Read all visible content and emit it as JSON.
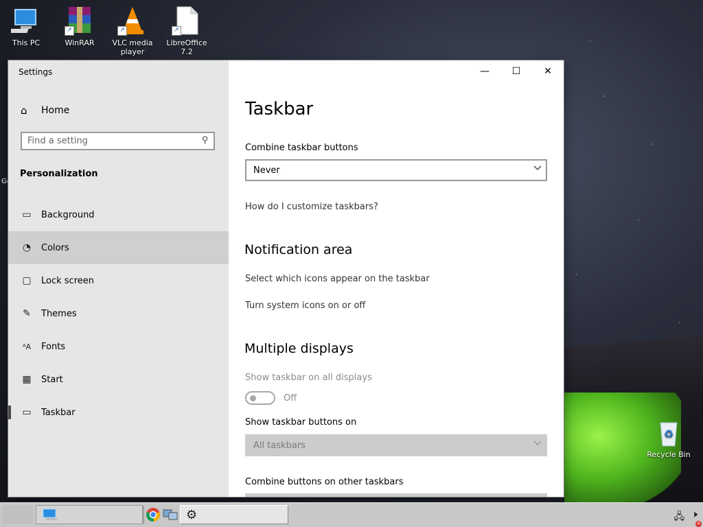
{
  "desktop": {
    "icons": [
      {
        "label": "This PC",
        "icon": "this-pc-icon"
      },
      {
        "label": "WinRAR",
        "icon": "winrar-icon"
      },
      {
        "label": "VLC media player",
        "icon": "vlc-icon"
      },
      {
        "label": "LibreOffice 7.2",
        "icon": "libreoffice-icon"
      },
      {
        "label": "Recycle Bin",
        "icon": "recycle-bin-icon"
      }
    ],
    "cut_text": "Go"
  },
  "window": {
    "title": "Settings",
    "controls": {
      "minimize": "—",
      "maximize": "☐",
      "close": "✕"
    }
  },
  "sidebar": {
    "home": "Home",
    "search_placeholder": "Find a setting",
    "section": "Personalization",
    "items": [
      {
        "label": "Background",
        "icon": "background-icon",
        "glyph": "▭"
      },
      {
        "label": "Colors",
        "icon": "palette-icon",
        "glyph": "🎨"
      },
      {
        "label": "Lock screen",
        "icon": "lock-screen-icon",
        "glyph": "▢"
      },
      {
        "label": "Themes",
        "icon": "themes-icon",
        "glyph": "✎"
      },
      {
        "label": "Fonts",
        "icon": "fonts-icon",
        "glyph": "ᴬA"
      },
      {
        "label": "Start",
        "icon": "start-icon",
        "glyph": "▦"
      },
      {
        "label": "Taskbar",
        "icon": "taskbar-icon",
        "glyph": "▭"
      }
    ],
    "hovered": "Colors",
    "selected": "Taskbar"
  },
  "main": {
    "title": "Taskbar",
    "combine_label": "Combine taskbar buttons",
    "combine_value": "Never",
    "help_link": "How do I customize taskbars?",
    "notification_heading": "Notification area",
    "notification_links": [
      "Select which icons appear on the taskbar",
      "Turn system icons on or off"
    ],
    "multiple_heading": "Multiple displays",
    "show_all_label": "Show taskbar on all displays",
    "show_all_state": "Off",
    "show_buttons_label": "Show taskbar buttons on",
    "show_buttons_value": "All taskbars",
    "combine_other_label": "Combine buttons on other taskbars"
  },
  "colors": {
    "sidebar_bg": "#e6e6e6",
    "hover_bg": "#cfcfcf",
    "taskbar_bg": "#c8c8c8",
    "disabled_text": "#8a8a8a"
  }
}
